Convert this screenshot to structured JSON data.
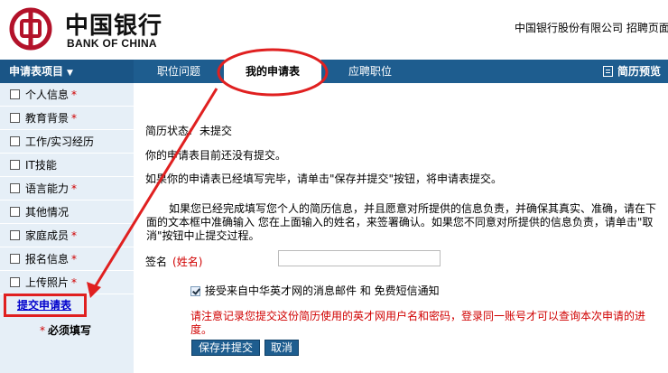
{
  "header": {
    "logo_cn": "中国银行",
    "logo_en": "BANK OF CHINA",
    "right_text": "中国银行股份有限公司 招聘页面"
  },
  "nav": {
    "section_label": "申请表项目",
    "tabs": [
      {
        "label": "职位问题"
      },
      {
        "label": "我的申请表"
      },
      {
        "label": "应聘职位"
      }
    ],
    "preview_label": "简历预览"
  },
  "sidebar": {
    "items": [
      {
        "label": "个人信息",
        "required": "*"
      },
      {
        "label": "教育背景",
        "required": "*"
      },
      {
        "label": "工作/实习经历",
        "required": ""
      },
      {
        "label": "IT技能",
        "required": ""
      },
      {
        "label": "语言能力",
        "required": "*"
      },
      {
        "label": "其他情况",
        "required": ""
      },
      {
        "label": "家庭成员",
        "required": "*"
      },
      {
        "label": "报名信息",
        "required": "*"
      },
      {
        "label": "上传照片",
        "required": "*"
      }
    ],
    "submit_link": "提交申请表",
    "must_note_star": "*",
    "must_note": "必须填写"
  },
  "main": {
    "status_label": "简历状态:",
    "status_value": "未提交",
    "not_submitted": "你的申请表目前还没有提交。",
    "instruction": "如果你的申请表已经填写完毕，请单击\"保存并提交\"按钮，将申请表提交。",
    "declaration": "如果您已经完成填写您个人的简历信息，并且愿意对所提供的信息负责，并确保其真实、准确，请在下面的文本框中准确输入 您在上面输入的姓名，来签署确认。如果您不同意对所提供的信息负责，请单击\"取消\"按钮中止提交过程。",
    "sign_label": "签名",
    "sign_hint": "(姓名)",
    "sign_value": "",
    "consent_label": "接受来自中华英才网的消息邮件 和 免费短信通知",
    "consent_checked": true,
    "red_note": "请注意记录您提交这份简历使用的英才网用户名和密码，登录同一账号才可以查询本次申请的进度。",
    "save_button": "保存并提交",
    "cancel_button": "取消"
  },
  "colors": {
    "nav_bg": "#1e5d8f",
    "sidebar_bg": "#e6eff7",
    "annotation_red": "#e02020",
    "required_red": "#d00000"
  }
}
